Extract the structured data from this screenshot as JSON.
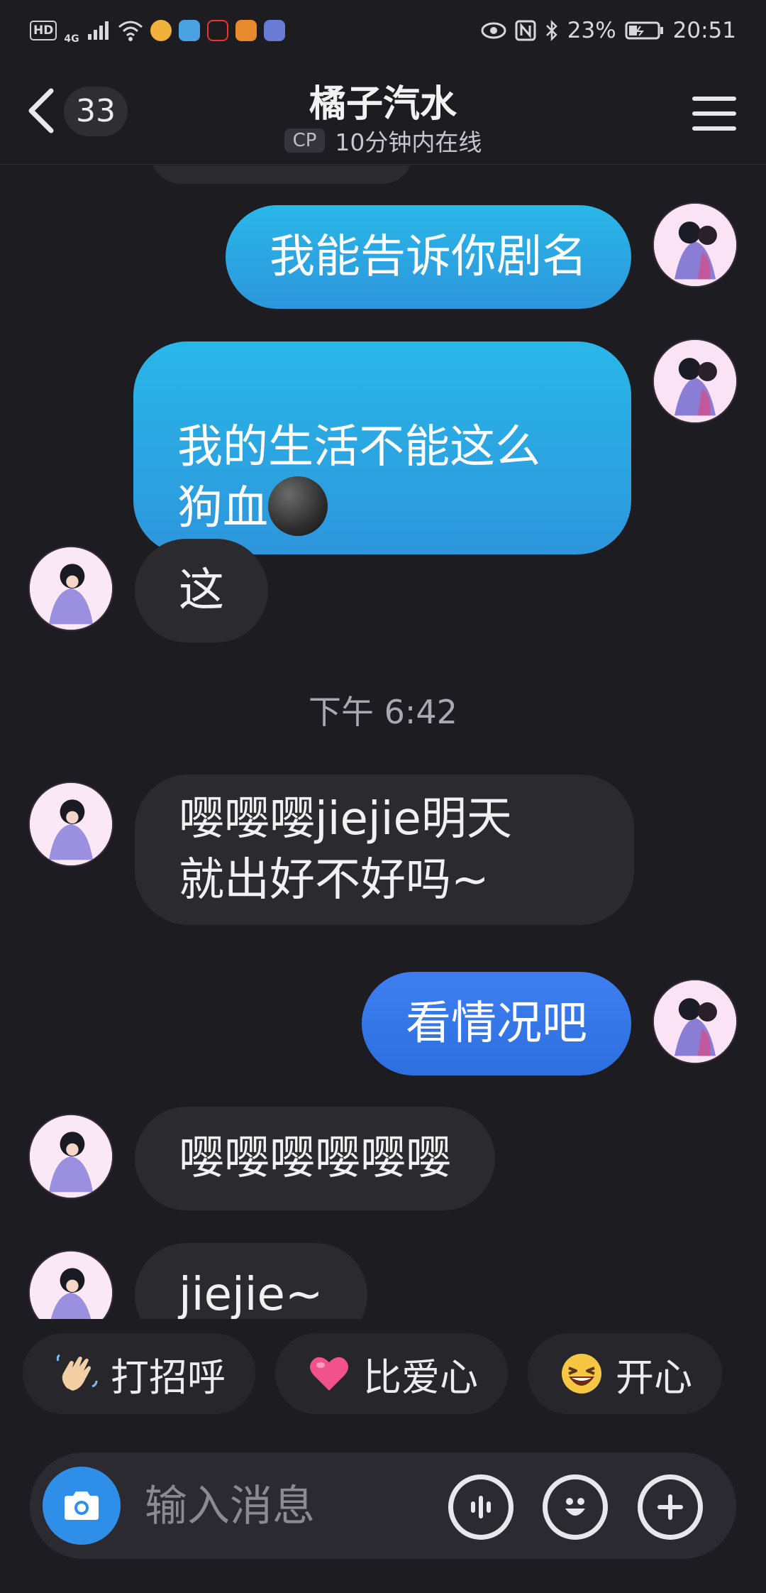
{
  "status_bar": {
    "hd": "HD",
    "network": "4G",
    "battery": "23%",
    "time": "20:51"
  },
  "header": {
    "unread_count": "33",
    "title": "橘子汽水",
    "cp_tag": "CP",
    "online_status": "10分钟内在线"
  },
  "messages": [
    {
      "side": "me",
      "text": "我能告诉你剧名"
    },
    {
      "side": "me",
      "text": "我的生活不能这么\n狗血"
    },
    {
      "side": "them",
      "text": "这"
    },
    {
      "type": "time",
      "text": "下午 6:42"
    },
    {
      "side": "them",
      "text": "嘤嘤嘤jiejie明天\n就出好不好吗~"
    },
    {
      "side": "me",
      "text": "看情况吧"
    },
    {
      "side": "them",
      "text": "嘤嘤嘤嘤嘤嘤"
    },
    {
      "side": "them",
      "text": "jiejie~"
    }
  ],
  "quick_replies": [
    {
      "label": "打招呼",
      "icon": "wave-hand-icon"
    },
    {
      "label": "比爱心",
      "icon": "heart-icon"
    },
    {
      "label": "开心",
      "icon": "laughing-face-icon"
    }
  ],
  "input": {
    "placeholder": "输入消息"
  },
  "colors": {
    "background": "#1d1d21",
    "my_bubble": "#29b7e8",
    "my_bubble_alt": "#3d7ff0",
    "their_bubble": "#2a2a2f",
    "camera_button": "#2f8fe8"
  }
}
